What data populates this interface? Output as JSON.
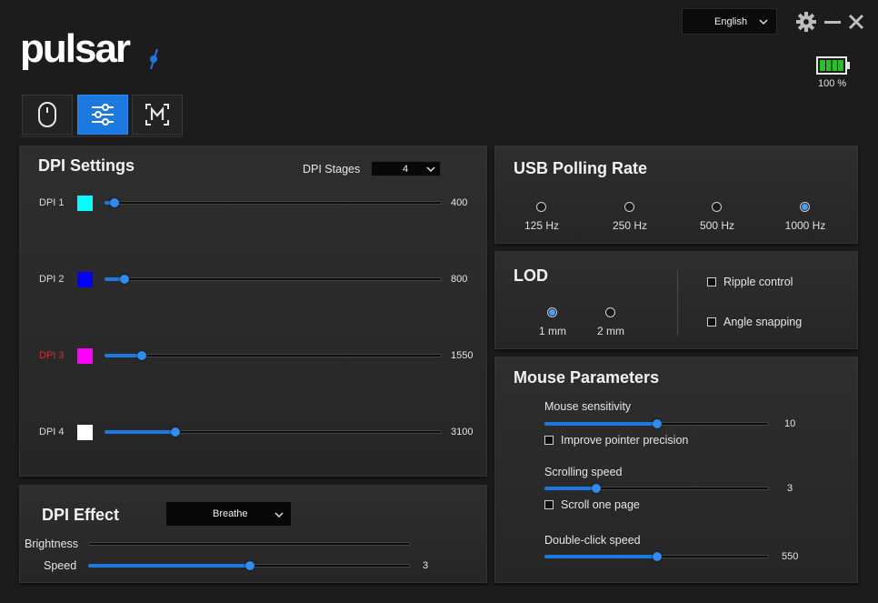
{
  "app": {
    "logo": "pulsar",
    "language": "English",
    "battery_pct": "100 %",
    "battery_level": 1.0,
    "accent_color": "#1b79e0"
  },
  "tabs": [
    {
      "icon": "mouse-icon",
      "active": false
    },
    {
      "icon": "sliders-icon",
      "active": true
    },
    {
      "icon": "macro-icon",
      "active": false
    }
  ],
  "dpi_settings": {
    "title": "DPI Settings",
    "stages_label": "DPI Stages",
    "stages_value": "4",
    "rows": [
      {
        "label": "DPI 1",
        "color": "#00ffff",
        "value": "400",
        "level": 0.03,
        "active": false
      },
      {
        "label": "DPI 2",
        "color": "#0000ff",
        "value": "800",
        "level": 0.06,
        "active": false
      },
      {
        "label": "DPI 3",
        "color": "#ff00ff",
        "value": "1550",
        "level": 0.11,
        "active": true
      },
      {
        "label": "DPI 4",
        "color": "#ffffff",
        "value": "3100",
        "level": 0.21,
        "active": false
      }
    ]
  },
  "dpi_effect": {
    "title": "DPI Effect",
    "effect_value": "Breathe",
    "brightness_label": "Brightness",
    "brightness_level": 0.0,
    "speed_label": "Speed",
    "speed_value": "3",
    "speed_level": 0.5
  },
  "usb_polling": {
    "title": "USB Polling Rate",
    "options": [
      {
        "label": "125 Hz",
        "selected": false
      },
      {
        "label": "250 Hz",
        "selected": false
      },
      {
        "label": "500 Hz",
        "selected": false
      },
      {
        "label": "1000 Hz",
        "selected": true
      }
    ]
  },
  "lod": {
    "title": "LOD",
    "options": [
      {
        "label": "1 mm",
        "selected": true
      },
      {
        "label": "2 mm",
        "selected": false
      }
    ],
    "ripple_label": "Ripple control",
    "ripple_checked": false,
    "angle_label": "Angle snapping",
    "angle_checked": false
  },
  "mouse_params": {
    "title": "Mouse Parameters",
    "sensitivity_label": "Mouse sensitivity",
    "sensitivity_value": "10",
    "sensitivity_level": 0.5,
    "precision_label": "Improve pointer precision",
    "precision_checked": false,
    "scroll_label": "Scrolling speed",
    "scroll_value": "3",
    "scroll_level": 0.23,
    "scroll_page_label": "Scroll one page",
    "scroll_page_checked": false,
    "dblclick_label": "Double-click speed",
    "dblclick_value": "550",
    "dblclick_level": 0.5
  }
}
